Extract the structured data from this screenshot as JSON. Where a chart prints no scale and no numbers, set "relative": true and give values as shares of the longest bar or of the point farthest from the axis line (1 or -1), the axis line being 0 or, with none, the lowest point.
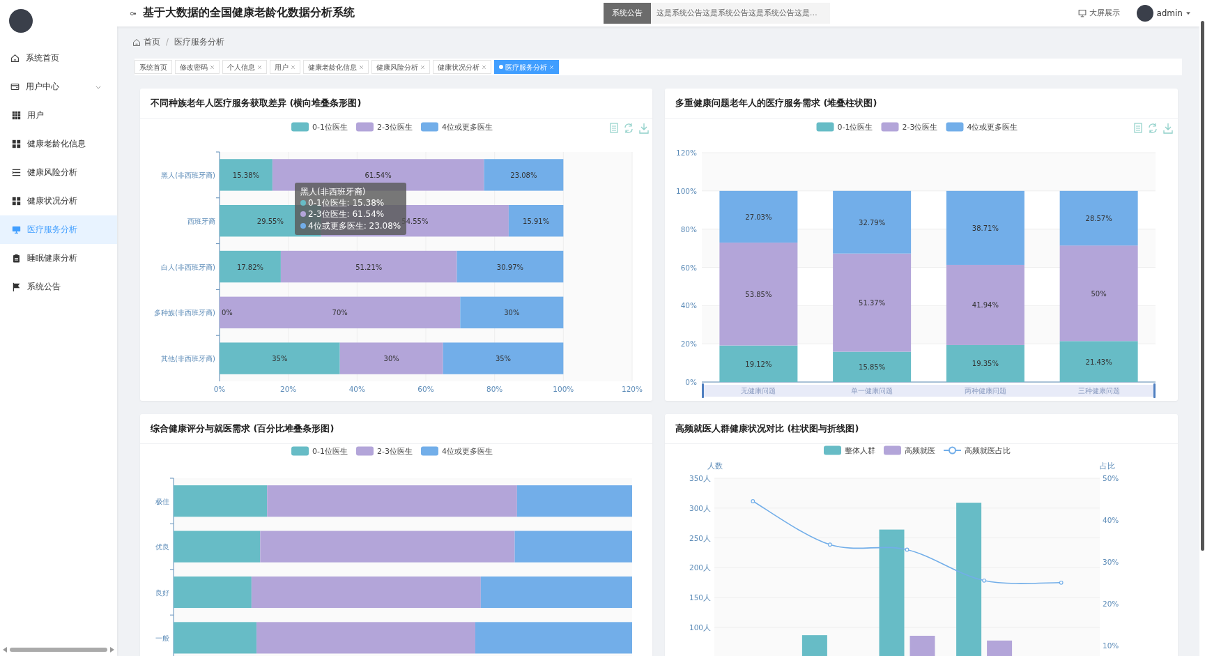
{
  "sidebar": {
    "items": [
      {
        "label": "系统首页",
        "selected": false
      },
      {
        "label": "用户中心",
        "selected": false,
        "expanded": true,
        "children": [
          {
            "label": "用户",
            "selected": false
          }
        ]
      },
      {
        "label": "健康老龄化信息",
        "selected": false
      },
      {
        "label": "健康风险分析",
        "selected": false
      },
      {
        "label": "健康状况分析",
        "selected": false
      },
      {
        "label": "医疗服务分析",
        "selected": true
      },
      {
        "label": "睡眠健康分析",
        "selected": false
      },
      {
        "label": "系统公告",
        "selected": false
      }
    ]
  },
  "header": {
    "title": "基于大数据的全国健康老龄化数据分析系统",
    "notice": {
      "label": "系统公告",
      "text": "这是系统公告这是系统公告这是系统公告这是…"
    },
    "big_screen": "大屏展示",
    "user": "admin"
  },
  "breadcrumb": {
    "items": [
      "首页",
      "医疗服务分析"
    ],
    "separator": "/"
  },
  "tabs": [
    {
      "label": "系统首页",
      "closable": false,
      "selected": false
    },
    {
      "label": "修改密码",
      "closable": true,
      "selected": false
    },
    {
      "label": "个人信息",
      "closable": true,
      "selected": false
    },
    {
      "label": "用户",
      "closable": true,
      "selected": false
    },
    {
      "label": "健康老龄化信息",
      "closable": true,
      "selected": false
    },
    {
      "label": "健康风险分析",
      "closable": true,
      "selected": false
    },
    {
      "label": "健康状况分析",
      "closable": true,
      "selected": false
    },
    {
      "label": "医疗服务分析",
      "closable": true,
      "selected": true
    }
  ],
  "panels": [
    {
      "title": "不同种族老年人医疗服务获取差异 (横向堆叠条形图)",
      "toolbox": true,
      "chart_data": {
        "type": "bar",
        "orientation": "horizontal",
        "stacked": true,
        "grid": true,
        "legend": true,
        "categories": [
          "黑人(非西班牙裔)",
          "西班牙裔",
          "白人(非西班牙裔)",
          "多种族(非西班牙裔)",
          "其他(非西班牙裔)"
        ],
        "series": [
          {
            "name": "0-1位医生",
            "color": "#67bcc6",
            "values": [
              15.38,
              29.55,
              17.82,
              0,
              35
            ]
          },
          {
            "name": "2-3位医生",
            "color": "#b3a5d9",
            "values": [
              61.54,
              54.55,
              51.21,
              70,
              30
            ]
          },
          {
            "name": "4位或更多医生",
            "color": "#72aee9",
            "values": [
              23.08,
              15.91,
              30.97,
              30,
              35
            ]
          }
        ],
        "value_labels": [
          [
            "15.38%",
            "29.55%",
            "17.82%",
            "0%",
            "35%"
          ],
          [
            "61.54%",
            "54.55%",
            "51.21%",
            "70%",
            "30%"
          ],
          [
            "23.08%",
            "15.91%",
            "30.97%",
            "30%",
            "35%"
          ]
        ],
        "xlim": [
          0,
          120
        ],
        "xticks": [
          {
            "value": 0,
            "label": "0%"
          },
          {
            "value": 20,
            "label": "20%"
          },
          {
            "value": 40,
            "label": "40%"
          },
          {
            "value": 60,
            "label": "60%"
          },
          {
            "value": 80,
            "label": "80%"
          },
          {
            "value": 100,
            "label": "100%"
          },
          {
            "value": 120,
            "label": "120%"
          }
        ]
      },
      "tooltip": {
        "title": "黑人(非西班牙裔)",
        "rows": [
          {
            "text": "0-1位医生: 15.38%",
            "color": "#67bcc6"
          },
          {
            "text": "2-3位医生: 61.54%",
            "color": "#b3a5d9"
          },
          {
            "text": "4位或更多医生: 23.08%",
            "color": "#72aee9"
          }
        ]
      }
    },
    {
      "title": "多重健康问题老年人的医疗服务需求 (堆叠柱状图)",
      "toolbox": true,
      "chart_data": {
        "type": "bar",
        "orientation": "vertical",
        "stacked": true,
        "grid": true,
        "legend": true,
        "categories": [
          "无健康问题",
          "单一健康问题",
          "两种健康问题",
          "三种健康问题"
        ],
        "series": [
          {
            "name": "0-1位医生",
            "color": "#67bcc6",
            "values": [
              19.12,
              15.85,
              19.35,
              21.43
            ]
          },
          {
            "name": "2-3位医生",
            "color": "#b3a5d9",
            "values": [
              53.85,
              51.37,
              41.94,
              50
            ]
          },
          {
            "name": "4位或更多医生",
            "color": "#72aee9",
            "values": [
              27.03,
              32.79,
              38.71,
              28.57
            ]
          }
        ],
        "value_labels": [
          [
            "19.12%",
            "15.85%",
            "19.35%",
            "21.43%"
          ],
          [
            "53.85%",
            "51.37%",
            "41.94%",
            "50%"
          ],
          [
            "27.03%",
            "32.79%",
            "38.71%",
            "28.57%"
          ]
        ],
        "ylim": [
          0,
          120
        ],
        "yticks": [
          {
            "value": 0,
            "label": "0%"
          },
          {
            "value": 20,
            "label": "20%"
          },
          {
            "value": 40,
            "label": "40%"
          },
          {
            "value": 60,
            "label": "60%"
          },
          {
            "value": 80,
            "label": "80%"
          },
          {
            "value": 100,
            "label": "100%"
          },
          {
            "value": 120,
            "label": "120%"
          }
        ]
      }
    },
    {
      "title": "综合健康评分与就医需求 (百分比堆叠条形图)",
      "chart_data": {
        "type": "bar",
        "orientation": "horizontal",
        "stacked": true,
        "relative": true,
        "legend": true,
        "categories": [
          "极佳",
          "优良",
          "良好",
          "一般"
        ],
        "series": [
          {
            "name": "0-1位医生",
            "color": "#67bcc6",
            "values": [
              0.204,
              0.189,
              0.17,
              0.181
            ]
          },
          {
            "name": "2-3位医生",
            "color": "#b3a5d9",
            "values": [
              0.545,
              0.555,
              0.5,
              0.477
            ]
          },
          {
            "name": "4位或更多医生",
            "color": "#72aee9",
            "values": [
              0.251,
              0.256,
              0.33,
              0.342
            ]
          }
        ]
      }
    },
    {
      "title": "高频就医人群健康状况对比 (柱状图与折线图)",
      "chart_data": {
        "type": "bar",
        "orientation": "vertical",
        "stacked": false,
        "grid": true,
        "legend": true,
        "ylabel": "人数",
        "y2label": "占比",
        "series": [
          {
            "name": "整体人群",
            "type": "bar",
            "color": "#67bcc6",
            "values": [
              null,
              87,
              264,
              309,
              null
            ]
          },
          {
            "name": "高频就医",
            "type": "bar",
            "color": "#b3a5d9",
            "values": [
              null,
              null,
              86,
              78,
              null
            ]
          },
          {
            "name": "高频就医占比",
            "type": "line",
            "axis": "y2",
            "marker": true,
            "color": "#72aee9",
            "values": [
              44.5,
              34.1,
              32.9,
              25.5,
              25.0
            ]
          }
        ],
        "ylim": [
          0,
          350
        ],
        "y2lim": [
          0,
          50
        ],
        "yticks": [
          {
            "value": 100,
            "label": "100人"
          },
          {
            "value": 150,
            "label": "150人"
          },
          {
            "value": 200,
            "label": "200人"
          },
          {
            "value": 250,
            "label": "250人"
          },
          {
            "value": 300,
            "label": "300人"
          },
          {
            "value": 350,
            "label": "350人"
          }
        ],
        "y2ticks": [
          {
            "value": 10,
            "label": "10%"
          },
          {
            "value": 20,
            "label": "20%"
          },
          {
            "value": 30,
            "label": "30%"
          },
          {
            "value": 40,
            "label": "40%"
          },
          {
            "value": 50,
            "label": "50%"
          }
        ]
      }
    }
  ]
}
